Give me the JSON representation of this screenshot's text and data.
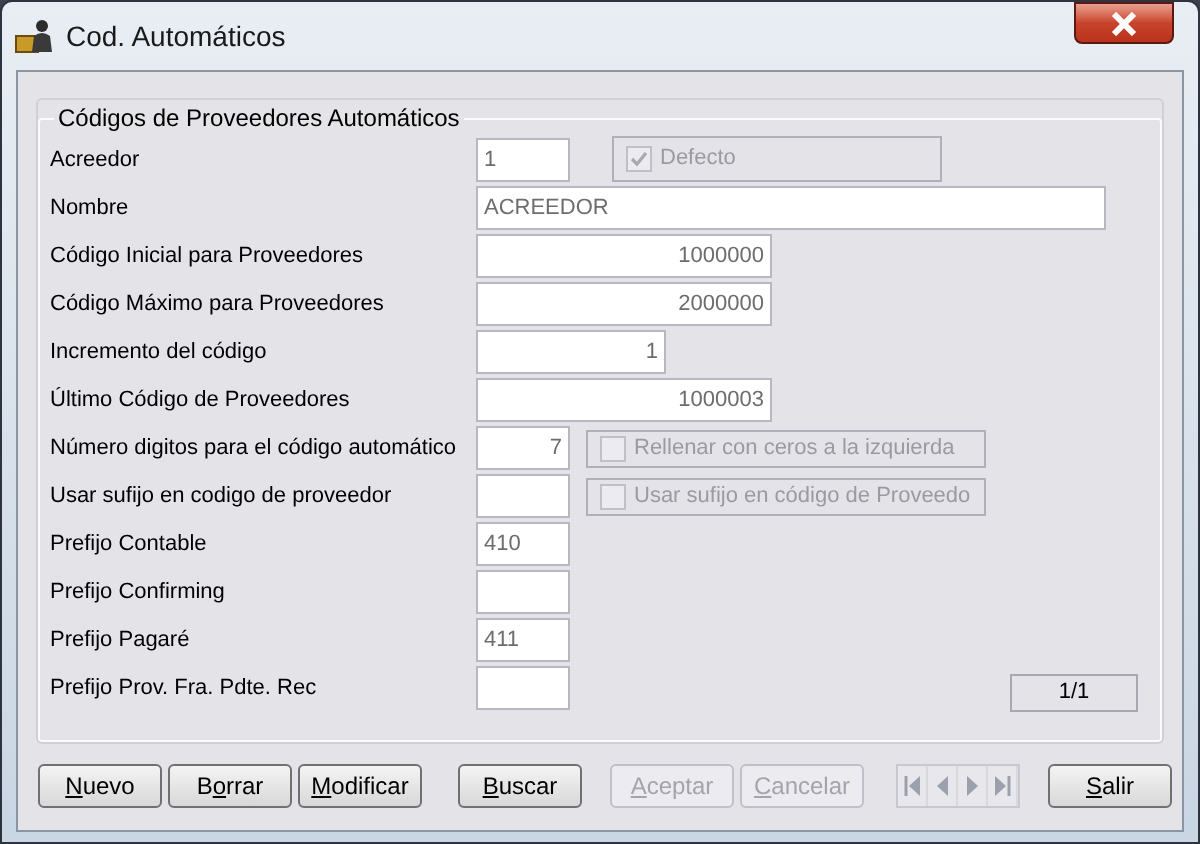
{
  "window": {
    "title": "Cod. Automáticos"
  },
  "group": {
    "title": "Códigos de Proveedores Automáticos"
  },
  "fields": [
    {
      "label": "Acreedor",
      "value": "1",
      "option": {
        "label": "Defecto",
        "checked": true,
        "disabled": true
      }
    },
    {
      "label": "Nombre",
      "value": "ACREEDOR"
    },
    {
      "label": "Código Inicial para Proveedores",
      "value": "1000000"
    },
    {
      "label": "Código Máximo para Proveedores",
      "value": "2000000"
    },
    {
      "label": "Incremento del código",
      "value": "1"
    },
    {
      "label": "Último Código de Proveedores",
      "value": "1000003"
    },
    {
      "label": "Número digitos para el código automático",
      "value": "7",
      "option": {
        "label": "Rellenar con ceros a la izquierda",
        "checked": false,
        "disabled": true
      }
    },
    {
      "label": "Usar sufijo en codigo de proveedor",
      "option": {
        "label": "Usar sufijo en código de Proveedo",
        "checked": false,
        "disabled": true
      }
    },
    {
      "label": "Prefijo Contable",
      "value": "410"
    },
    {
      "label": "Prefijo Confirming"
    },
    {
      "label": "Prefijo Pagaré",
      "value": "411"
    },
    {
      "label": "Prefijo Prov. Fra. Pdte. Rec"
    }
  ],
  "record_counter": "1/1",
  "buttons": [
    {
      "label": "Nuevo",
      "disabled": false
    },
    {
      "label": "Borrar",
      "disabled": false
    },
    {
      "label": "Modificar",
      "disabled": false
    },
    {
      "label": "Buscar",
      "disabled": false
    },
    {
      "label": "Aceptar",
      "disabled": true
    },
    {
      "label": "Cancelar",
      "disabled": true
    },
    {
      "label": "Salir",
      "disabled": false
    }
  ],
  "navigator": {
    "disabled": true
  }
}
